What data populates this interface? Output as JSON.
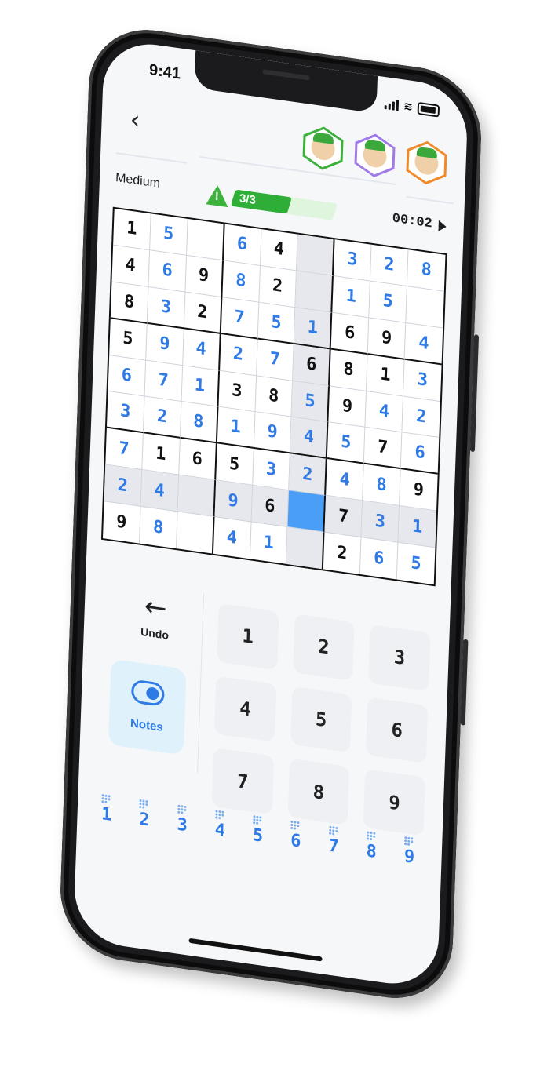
{
  "status_bar": {
    "time": "9:41"
  },
  "header": {
    "back_icon": "‹",
    "avatars": [
      {
        "name_icon": "green-hexagon-avatar-icon",
        "color": "#3cb23c"
      },
      {
        "name_icon": "purple-hexagon-avatar-icon",
        "color": "#a07ae6"
      },
      {
        "name_icon": "orange-hexagon-avatar-icon",
        "color": "#f08a2a"
      }
    ]
  },
  "info": {
    "difficulty": "Medium",
    "mistakes": "3/3",
    "mistakes_fill": 0.55,
    "timer": "00:02"
  },
  "board": {
    "rows": [
      [
        [
          "1",
          "k"
        ],
        [
          "5",
          "b"
        ],
        [
          "",
          ""
        ],
        [
          "6",
          "b"
        ],
        [
          "4",
          "k"
        ],
        [
          "",
          ""
        ],
        [
          "3",
          "b"
        ],
        [
          "2",
          "b"
        ],
        [
          "8",
          "b"
        ]
      ],
      [
        [
          "4",
          "k"
        ],
        [
          "6",
          "b"
        ],
        [
          "9",
          "k"
        ],
        [
          "8",
          "b"
        ],
        [
          "2",
          "k"
        ],
        [
          "",
          ""
        ],
        [
          "1",
          "b"
        ],
        [
          "5",
          "b"
        ],
        [
          "",
          ""
        ]
      ],
      [
        [
          "8",
          "k"
        ],
        [
          "3",
          "b"
        ],
        [
          "2",
          "k"
        ],
        [
          "7",
          "b"
        ],
        [
          "5",
          "b"
        ],
        [
          "1",
          "b"
        ],
        [
          "6",
          "k"
        ],
        [
          "9",
          "k"
        ],
        [
          "4",
          "b"
        ]
      ],
      [
        [
          "5",
          "k"
        ],
        [
          "9",
          "b"
        ],
        [
          "4",
          "b"
        ],
        [
          "2",
          "b"
        ],
        [
          "7",
          "b"
        ],
        [
          "6",
          "k"
        ],
        [
          "8",
          "k"
        ],
        [
          "1",
          "k"
        ],
        [
          "3",
          "b"
        ]
      ],
      [
        [
          "6",
          "b"
        ],
        [
          "7",
          "b"
        ],
        [
          "1",
          "b"
        ],
        [
          "3",
          "k"
        ],
        [
          "8",
          "k"
        ],
        [
          "5",
          "b"
        ],
        [
          "9",
          "k"
        ],
        [
          "4",
          "b"
        ],
        [
          "2",
          "b"
        ]
      ],
      [
        [
          "3",
          "b"
        ],
        [
          "2",
          "b"
        ],
        [
          "8",
          "b"
        ],
        [
          "1",
          "b"
        ],
        [
          "9",
          "b"
        ],
        [
          "4",
          "b"
        ],
        [
          "5",
          "b"
        ],
        [
          "7",
          "k"
        ],
        [
          "6",
          "b"
        ]
      ],
      [
        [
          "7",
          "b"
        ],
        [
          "1",
          "k"
        ],
        [
          "6",
          "k"
        ],
        [
          "5",
          "k"
        ],
        [
          "3",
          "b"
        ],
        [
          "2",
          "b"
        ],
        [
          "4",
          "b"
        ],
        [
          "8",
          "b"
        ],
        [
          "9",
          "k"
        ]
      ],
      [
        [
          "2",
          "b"
        ],
        [
          "4",
          "b"
        ],
        [
          "",
          ""
        ],
        [
          "9",
          "b"
        ],
        [
          "6",
          "k"
        ],
        [
          "",
          ""
        ],
        [
          "7",
          "k"
        ],
        [
          "3",
          "b"
        ],
        [
          "1",
          "b"
        ]
      ],
      [
        [
          "9",
          "k"
        ],
        [
          "8",
          "b"
        ],
        [
          "",
          ""
        ],
        [
          "4",
          "b"
        ],
        [
          "1",
          "b"
        ],
        [
          "",
          ""
        ],
        [
          "2",
          "k"
        ],
        [
          "6",
          "b"
        ],
        [
          "5",
          "b"
        ]
      ]
    ],
    "selected": [
      7,
      5
    ],
    "highlight_color": "#e6e8ed",
    "selected_color": "#4a9ef5",
    "given_color": "#111111",
    "entered_color": "#2f7ae5"
  },
  "controls": {
    "undo_icon": "←",
    "undo_label": "Undo",
    "notes_label": "Notes"
  },
  "keypad": [
    "1",
    "2",
    "3",
    "4",
    "5",
    "6",
    "7",
    "8",
    "9"
  ],
  "counters": [
    "1",
    "2",
    "3",
    "4",
    "5",
    "6",
    "7",
    "8",
    "9"
  ]
}
